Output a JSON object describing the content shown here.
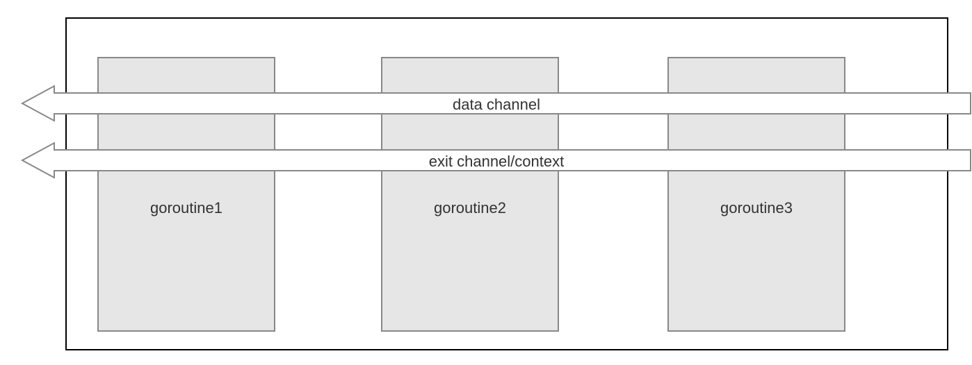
{
  "diagram": {
    "container": {},
    "goroutines": [
      {
        "label": "goroutine1"
      },
      {
        "label": "goroutine2"
      },
      {
        "label": "goroutine3"
      }
    ],
    "arrows": [
      {
        "label": "data channel"
      },
      {
        "label": "exit channel/context"
      }
    ],
    "colors": {
      "fill": "#e6e6e6",
      "stroke_dark": "#000000",
      "stroke_light": "#888888",
      "text": "#333333"
    }
  }
}
